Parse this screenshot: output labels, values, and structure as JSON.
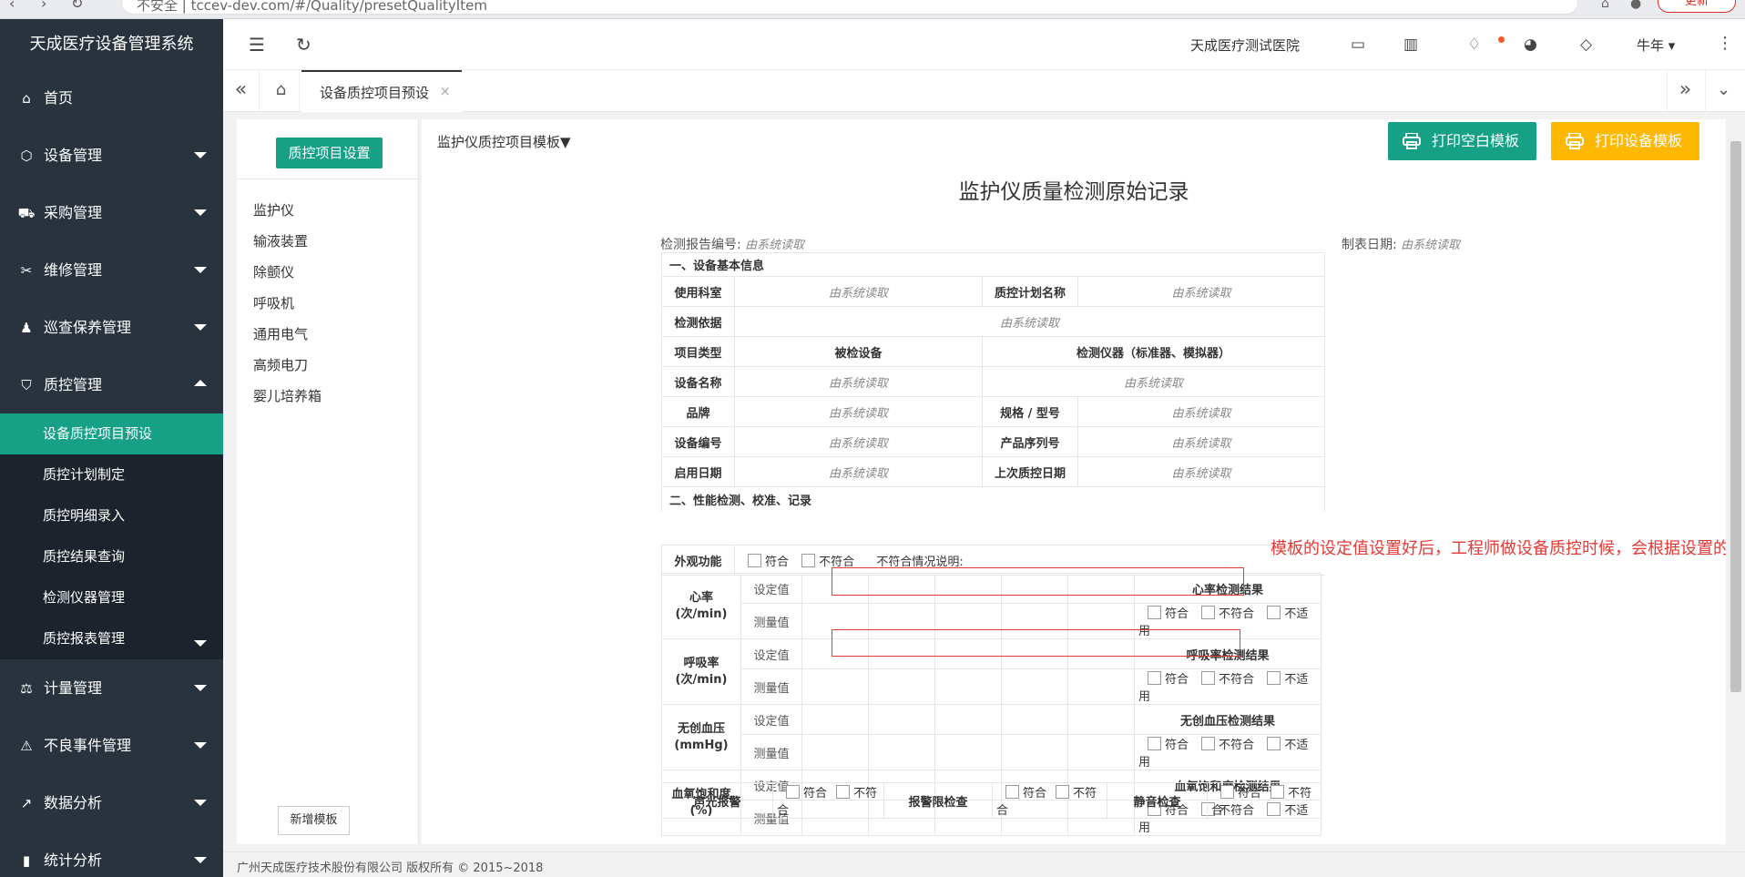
{
  "browser": {
    "address": "不安全 | tccev-dev.com/#/Quality/presetQualityItem",
    "update_label": "更新"
  },
  "app": {
    "title": "天成医疗设备管理系统"
  },
  "sidebar": {
    "items": [
      {
        "label": "首页",
        "icon": "home-icon"
      },
      {
        "label": "设备管理",
        "icon": "cube-icon"
      },
      {
        "label": "采购管理",
        "icon": "cart-icon"
      },
      {
        "label": "维修管理",
        "icon": "wrench-icon"
      },
      {
        "label": "巡查保养管理",
        "icon": "person-icon"
      },
      {
        "label": "质控管理",
        "icon": "shield-check-icon"
      }
    ],
    "submenu": [
      {
        "label": "设备质控项目预设"
      },
      {
        "label": "质控计划制定"
      },
      {
        "label": "质控明细录入"
      },
      {
        "label": "质控结果查询"
      },
      {
        "label": "检测仪器管理"
      },
      {
        "label": "质控报表管理"
      }
    ],
    "items_after": [
      {
        "label": "计量管理",
        "icon": "scale-icon"
      },
      {
        "label": "不良事件管理",
        "icon": "warning-icon"
      },
      {
        "label": "数据分析",
        "icon": "chart-line-icon"
      },
      {
        "label": "统计分析",
        "icon": "bar-chart-icon"
      }
    ]
  },
  "header": {
    "hospital": "天成医疗测试医院",
    "user": "牛年",
    "icons": [
      "collapse-menu-icon",
      "refresh-icon",
      "screen-icon",
      "book-icon",
      "bell-icon",
      "palette-icon",
      "tag-icon",
      "more-icon"
    ]
  },
  "tabs": {
    "active_label": "设备质控项目预设",
    "close_glyph": "×"
  },
  "left_panel": {
    "settings_button": "质控项目设置",
    "items": [
      "监护仪",
      "输液装置",
      "除颤仪",
      "呼吸机",
      "通用电气",
      "高频电刀",
      "婴儿培养箱"
    ],
    "add_button": "新增模板"
  },
  "main": {
    "template_select": "监护仪质控项目模板▼",
    "print_blank": "打印空白模板",
    "print_device": "打印设备模板",
    "doc_title": "监护仪质量检测原始记录",
    "report_no_label": "检测报告编号:",
    "date_label": "制表日期:",
    "auto_read": "由系统读取",
    "annotation": "模板的设定值设置好后，工程师做设备质控时候，会根据设置的值在这里显示"
  },
  "section1": {
    "title": "一、设备基本信息",
    "dept": "使用科室",
    "plan_name": "质控计划名称",
    "basis": "检测依据",
    "item_type": "项目类型",
    "tested_device": "被检设备",
    "instrument": "检测仪器（标准器、模拟器）",
    "device_name": "设备名称",
    "brand": "品牌",
    "model": "规格 / 型号",
    "device_no": "设备编号",
    "serial_no": "产品序列号",
    "enable_date": "启用日期",
    "last_qc_date": "上次质控日期"
  },
  "section2": {
    "title": "二、性能检测、校准、记录",
    "appearance": "外观功能",
    "pass": "符合",
    "fail": "不符合",
    "na": "不适用",
    "fail_desc": "不符合情况说明:",
    "set_value": "设定值",
    "measured_value": "测量值",
    "params": [
      {
        "name": "心率",
        "unit": "(次/min)",
        "result": "心率检测结果"
      },
      {
        "name": "呼吸率",
        "unit": "(次/min)",
        "result": "呼吸率检测结果"
      },
      {
        "name": "无创血压",
        "unit": "(mmHg)",
        "result": "无创血压检测结果"
      },
      {
        "name": "血氧饱和度",
        "unit": "(%)",
        "result": "血氧饱和度检测结果"
      }
    ],
    "alarm_sound": "声光报警",
    "alarm_limit": "报警限检查",
    "mute_check": "静音检查"
  },
  "footer": {
    "copyright": "广州天成医疗技术股份有限公司 版权所有 © 2015~2018"
  }
}
